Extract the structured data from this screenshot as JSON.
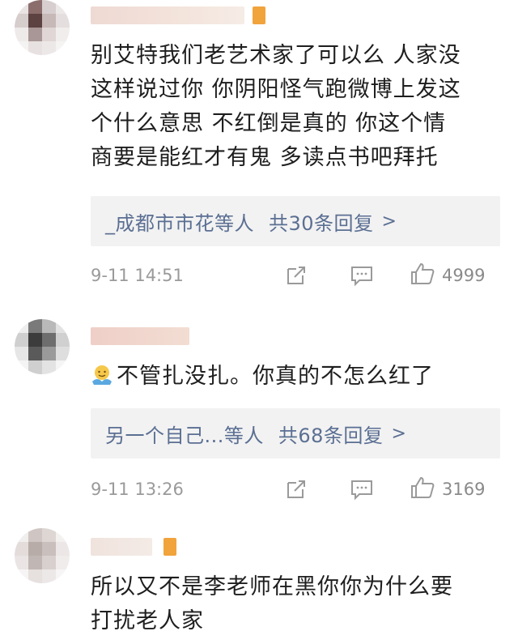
{
  "comments": [
    {
      "text": "别艾特我们老艺术家了可以么 人家没这样说过你 你阴阳怪气跑微博上发这个什么意思 不红倒是真的 你这个情商要是能红才有鬼 多读点书吧拜托",
      "lines": [
        "别艾特我们老艺术家了可以么 人家没",
        "这样说过你 你阴阳怪气跑微博上发这",
        "个什么意思 不红倒是真的 你这个情",
        "商要是能红才有鬼 多读点书吧拜托"
      ],
      "reply_names": "_成都市市花等人",
      "reply_count": "共30条回复",
      "reply_arrow": ">",
      "time": "9-11 14:51",
      "likes": "4999"
    },
    {
      "emoji": "hug-emoji",
      "text": "不管扎没扎。你真的不怎么红了",
      "reply_names": "另一个自己...等人",
      "reply_count": "共68条回复",
      "reply_arrow": ">",
      "time": "9-11 13:26",
      "likes": "3169"
    },
    {
      "lines": [
        "所以又不是李老师在黑你你为什么要",
        "打扰老人家"
      ]
    }
  ],
  "icons": {
    "share": "share-icon",
    "comment": "comment-icon",
    "like": "thumbs-up-icon"
  },
  "colors": {
    "reply_link": "#5b6f93",
    "meta_gray": "#9a9a9a",
    "reply_bg": "#f2f2f2"
  }
}
